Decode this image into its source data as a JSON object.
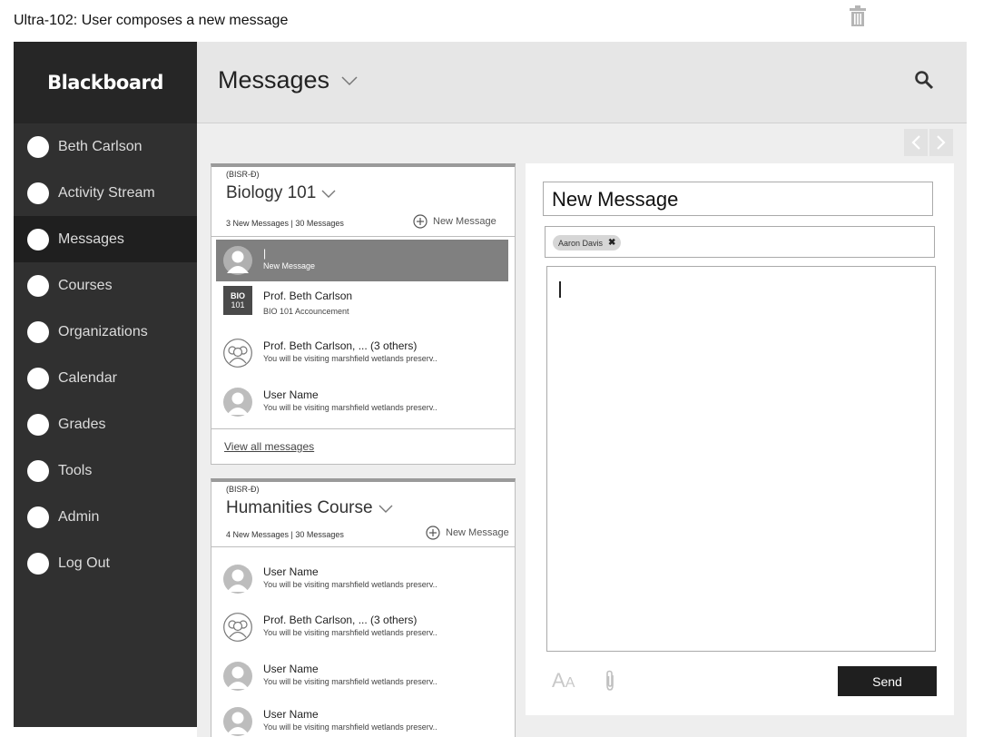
{
  "caption": "Ultra-102: User composes a new message",
  "sidebar": {
    "logo": "Blackboard",
    "items": [
      {
        "label": "Beth Carlson"
      },
      {
        "label": "Activity Stream"
      },
      {
        "label": "Messages",
        "active": true
      },
      {
        "label": "Courses"
      },
      {
        "label": "Organizations"
      },
      {
        "label": "Calendar"
      },
      {
        "label": "Grades"
      },
      {
        "label": "Tools"
      },
      {
        "label": "Admin"
      },
      {
        "label": "Log Out"
      }
    ]
  },
  "header": {
    "title": "Messages"
  },
  "courses": [
    {
      "code": "(BISR-Ð)",
      "title": "Biology 101",
      "counts": "3 New Messages  |  30 Messages",
      "new_message_label": "New Message",
      "messages": [
        {
          "sender": "|",
          "preview": "New Message",
          "avatar": "person",
          "selected": true
        },
        {
          "sender": "Prof. Beth Carlson",
          "preview": "BIO 101 Accouncement",
          "avatar": "bio"
        },
        {
          "sender": "Prof. Beth Carlson, ... (3 others)",
          "preview": "You will be visiting marshfield wetlands preserv..",
          "avatar": "group"
        },
        {
          "sender": "User Name",
          "preview": "You will be visiting marshfield wetlands preserv..",
          "avatar": "person"
        }
      ],
      "view_all": "View all messages"
    },
    {
      "code": "(BISR-Ð)",
      "title": "Humanities Course",
      "counts": "4 New Messages  |  30 Messages",
      "new_message_label": "New Message",
      "messages": [
        {
          "sender": "User Name",
          "preview": "You will be visiting marshfield wetlands preserv..",
          "avatar": "person"
        },
        {
          "sender": "Prof. Beth Carlson, ... (3 others)",
          "preview": "You will be visiting marshfield wetlands preserv..",
          "avatar": "group"
        },
        {
          "sender": "User Name",
          "preview": "You will be visiting marshfield wetlands preserv..",
          "avatar": "person"
        },
        {
          "sender": "User Name",
          "preview": "You will be visiting marshfield wetlands preserv..",
          "avatar": "person"
        }
      ]
    }
  ],
  "bio_badge": {
    "line1": "BIO",
    "line2": "101"
  },
  "compose": {
    "subject": "New Message",
    "recipient": "Aaron Davis",
    "recipient_remove": "✖",
    "font_tool": {
      "big": "A",
      "small": "A"
    },
    "send_label": "Send"
  },
  "colors": {
    "sidebar": "#262626",
    "nav": "#303030",
    "topbar": "#e6e6e6",
    "selected_row": "#808080",
    "send_button": "#1f1f1f"
  }
}
